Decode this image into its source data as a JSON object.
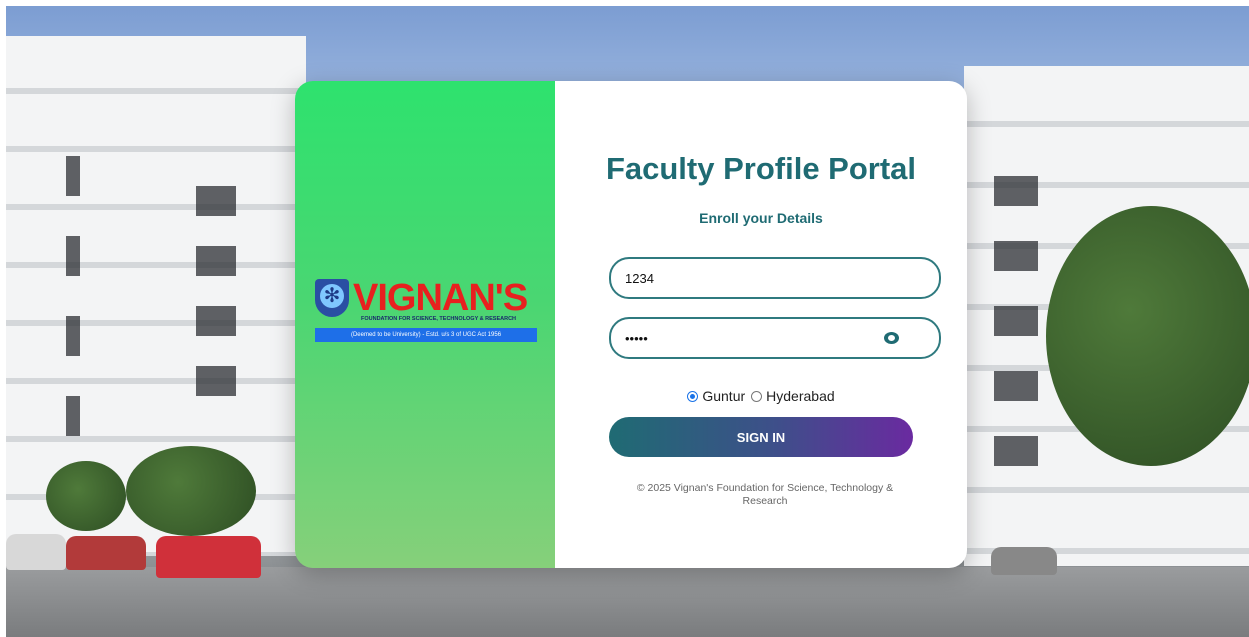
{
  "background": {
    "scene": "campus-building-photo"
  },
  "brand": {
    "name": "VIGNAN'S",
    "tagline": "FOUNDATION FOR SCIENCE, TECHNOLOGY & RESEARCH",
    "strip": "(Deemed to be University) - Estd. u/s 3 of UGC Act 1956",
    "color": "#e8201f"
  },
  "login": {
    "title": "Faculty Profile Portal",
    "subtitle": "Enroll your Details",
    "username_value": "1234",
    "password_value": "•••••",
    "campus_options": [
      {
        "label": "Guntur",
        "selected": true
      },
      {
        "label": "Hyderabad",
        "selected": false
      }
    ],
    "sign_in_label": "SIGN IN",
    "footer": "© 2025 Vignan's Foundation for Science, Technology & Research"
  },
  "colors": {
    "accent": "#1f6b73",
    "left_panel": "#2ee26e",
    "button_end": "#6a2aa0",
    "radio": "#1a73e8"
  },
  "icons": {
    "password_toggle": "eye-icon",
    "brand_logo": "shield-icon"
  }
}
